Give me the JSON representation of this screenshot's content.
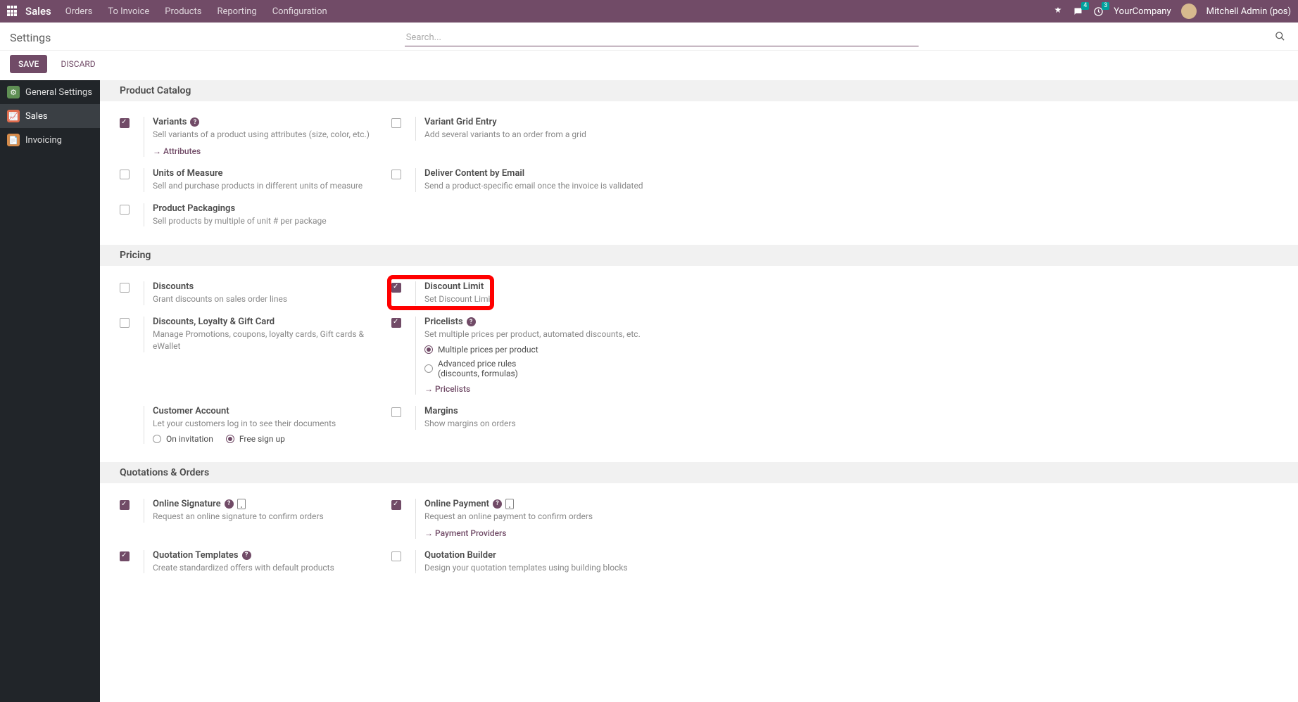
{
  "nav": {
    "brand": "Sales",
    "items": [
      "Orders",
      "To Invoice",
      "Products",
      "Reporting",
      "Configuration"
    ],
    "chat_badge": "4",
    "clock_badge": "3",
    "company": "YourCompany",
    "user": "Mitchell Admin (pos)"
  },
  "header": {
    "title": "Settings",
    "search_placeholder": "Search...",
    "save": "SAVE",
    "discard": "DISCARD"
  },
  "sidebar": {
    "items": [
      {
        "label": "General Settings",
        "color": "#5f8f54",
        "active": false
      },
      {
        "label": "Sales",
        "color": "#e06c4d",
        "active": true
      },
      {
        "label": "Invoicing",
        "color": "#d68b4a",
        "active": false
      }
    ]
  },
  "sections": {
    "catalog": {
      "title": "Product Catalog",
      "variants": {
        "title": "Variants",
        "desc": "Sell variants of a product using attributes (size, color, etc.)",
        "link": "Attributes"
      },
      "grid": {
        "title": "Variant Grid Entry",
        "desc": "Add several variants to an order from a grid"
      },
      "uom": {
        "title": "Units of Measure",
        "desc": "Sell and purchase products in different units of measure"
      },
      "deliver": {
        "title": "Deliver Content by Email",
        "desc": "Send a product-specific email once the invoice is validated"
      },
      "pack": {
        "title": "Product Packagings",
        "desc": "Sell products by multiple of unit # per package"
      }
    },
    "pricing": {
      "title": "Pricing",
      "discounts": {
        "title": "Discounts",
        "desc": "Grant discounts on sales order lines"
      },
      "limit": {
        "title": "Discount Limit",
        "desc": "Set Discount Limit"
      },
      "loyalty": {
        "title": "Discounts, Loyalty & Gift Card",
        "desc": "Manage Promotions, coupons, loyalty cards, Gift cards & eWallet"
      },
      "pricelists": {
        "title": "Pricelists",
        "desc": "Set multiple prices per product, automated discounts, etc.",
        "opt1": "Multiple prices per product",
        "opt2": "Advanced price rules",
        "opt2b": "(discounts, formulas)",
        "link": "Pricelists"
      },
      "account": {
        "title": "Customer Account",
        "desc": "Let your customers log in to see their documents",
        "opt1": "On invitation",
        "opt2": "Free sign up"
      },
      "margins": {
        "title": "Margins",
        "desc": "Show margins on orders"
      }
    },
    "quotes": {
      "title": "Quotations & Orders",
      "sig": {
        "title": "Online Signature",
        "desc": "Request an online signature to confirm orders"
      },
      "pay": {
        "title": "Online Payment",
        "desc": "Request an online payment to confirm orders",
        "link": "Payment Providers"
      },
      "tmpl": {
        "title": "Quotation Templates",
        "desc": "Create standardized offers with default products"
      },
      "builder": {
        "title": "Quotation Builder",
        "desc": "Design your quotation templates using building blocks"
      }
    }
  }
}
